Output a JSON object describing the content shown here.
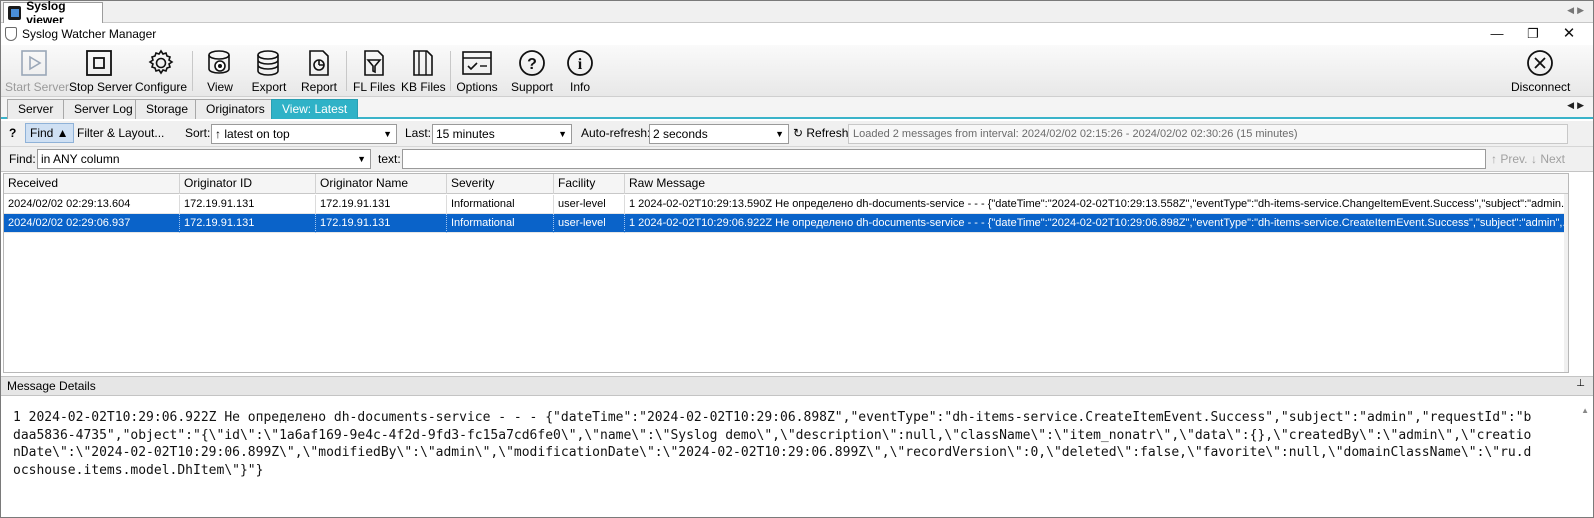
{
  "doc_tab": {
    "title": "Syslog viewer"
  },
  "window": {
    "title": "Syslog Watcher Manager"
  },
  "toolbar": {
    "start_server": "Start Server",
    "stop_server": "Stop Server",
    "configure": "Configure",
    "view": "View",
    "export": "Export",
    "report": "Report",
    "fl_files": "FL Files",
    "kb_files": "KB Files",
    "options": "Options",
    "support": "Support",
    "info": "Info",
    "disconnect": "Disconnect"
  },
  "view_tabs": [
    "Server",
    "Server Log",
    "Storage",
    "Originators",
    "View: Latest"
  ],
  "active_tab": "View: Latest",
  "filter_bar": {
    "help": "?",
    "find_toggle": "Find ▲",
    "filter_layout": "Filter & Layout...",
    "sort_label": "Sort:",
    "sort_value": "↑ latest on top",
    "last_label": "Last:",
    "last_value": "15 minutes",
    "autorefresh_label": "Auto-refresh:",
    "autorefresh_value": "2 seconds",
    "refresh": "↻ Refresh",
    "status": "Loaded 2 messages from interval: 2024/02/02 02:15:26 - 2024/02/02 02:30:26 (15 minutes)"
  },
  "find_bar": {
    "find_label": "Find:",
    "find_scope": "in ANY column",
    "text_label": "text:",
    "text_value": "",
    "prev": "↑ Prev.",
    "next": "↓ Next"
  },
  "grid": {
    "columns": [
      "Received",
      "Originator ID",
      "Originator Name",
      "Severity",
      "Facility",
      "Raw Message"
    ],
    "rows": [
      [
        "2024/02/02 02:29:13.604",
        "172.19.91.131",
        "172.19.91.131",
        "Informational",
        "user-level",
        "1 2024-02-02T10:29:13.590Z Не определено dh-documents-service - - - {\"dateTime\":\"2024-02-02T10:29:13.558Z\",\"eventType\":\"dh-items-service.ChangeItemEvent.Success\",\"subject\":\"admin..."
      ],
      [
        "2024/02/02 02:29:06.937",
        "172.19.91.131",
        "172.19.91.131",
        "Informational",
        "user-level",
        "1 2024-02-02T10:29:06.922Z Не определено dh-documents-service - - - {\"dateTime\":\"2024-02-02T10:29:06.898Z\",\"eventType\":\"dh-items-service.CreateItemEvent.Success\",\"subject\":\"admin\",..."
      ]
    ],
    "selected_row": 1
  },
  "details": {
    "title": "Message Details",
    "pin": "⊥",
    "text": "1 2024-02-02T10:29:06.922Z Не определено dh-documents-service - - - {\"dateTime\":\"2024-02-02T10:29:06.898Z\",\"eventType\":\"dh-items-service.CreateItemEvent.Success\",\"subject\":\"admin\",\"requestId\":\"bdaa5836-4735\",\"object\":\"{\\\"id\\\":\\\"1a6af169-9e4c-4f2d-9fd3-fc15a7cd6fe0\\\",\\\"name\\\":\\\"Syslog demo\\\",\\\"description\\\":null,\\\"className\\\":\\\"item_nonatr\\\",\\\"data\\\":{},\\\"createdBy\\\":\\\"admin\\\",\\\"creationDate\\\":\\\"2024-02-02T10:29:06.899Z\\\",\\\"modifiedBy\\\":\\\"admin\\\",\\\"modificationDate\\\":\\\"2024-02-02T10:29:06.899Z\\\",\\\"recordVersion\\\":0,\\\"deleted\\\":false,\\\"favorite\\\":null,\\\"domainClassName\\\":\\\"ru.docshouse.items.model.DhItem\\\"}\"}"
  },
  "colors": {
    "accent_tab": "#2fb2c7",
    "selection": "#0a63c9"
  }
}
